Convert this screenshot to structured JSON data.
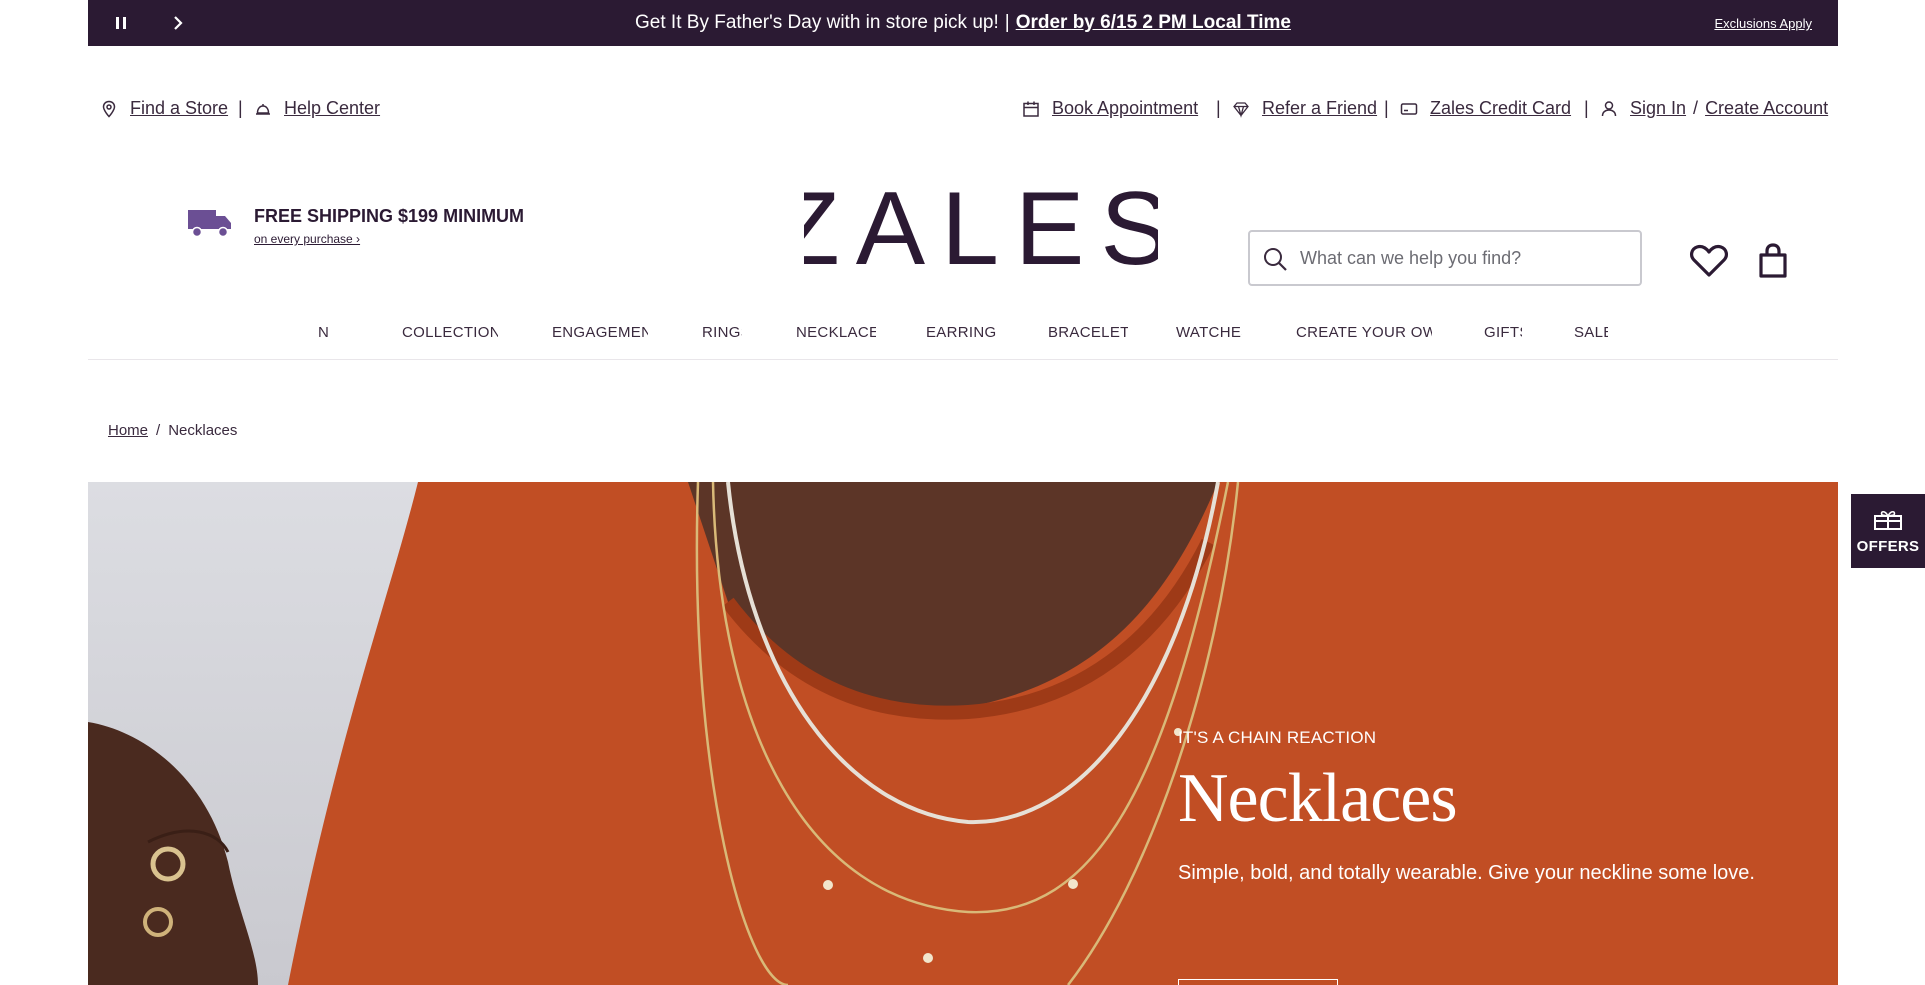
{
  "promo": {
    "pause_label": "| |",
    "next_label": "›",
    "message": "Get It By Father's Day with in store pick up!",
    "separator": "|",
    "link": "Order by 6/15 2 PM Local Time",
    "exclusions": "Exclusions Apply"
  },
  "utility": {
    "find_store": "Find a Store",
    "help_center": "Help Center",
    "book_appointment": "Book Appointment",
    "refer_friend": "Refer a Friend",
    "credit_card": "Zales Credit Card",
    "sign_in": "Sign In",
    "slash": "/",
    "create_account": "Create Account",
    "divider": "|"
  },
  "header": {
    "shipping_title": "FREE SHIPPING $199 MINIMUM",
    "shipping_sub": "on every purchase ›",
    "logo_text": "ZALES",
    "search_placeholder": "What can we help you find?"
  },
  "nav": {
    "items": [
      "N",
      "COLLECTIONS",
      "ENGAGEMENT",
      "RINGS",
      "NECKLACES",
      "EARRINGS",
      "BRACELETS",
      "WATCHES",
      "CREATE YOUR OWN",
      "GIFTS",
      "SALE"
    ]
  },
  "breadcrumb": {
    "home": "Home",
    "separator": "/",
    "current": "Necklaces"
  },
  "hero": {
    "eyebrow": "IT'S A CHAIN REACTION",
    "title": "Necklaces",
    "description": "Simple, bold, and totally wearable. Give your neckline some love."
  },
  "offers": {
    "label": "OFFERS"
  },
  "colors": {
    "brand_dark": "#2b1a33",
    "hero_orange": "#c14e24"
  }
}
